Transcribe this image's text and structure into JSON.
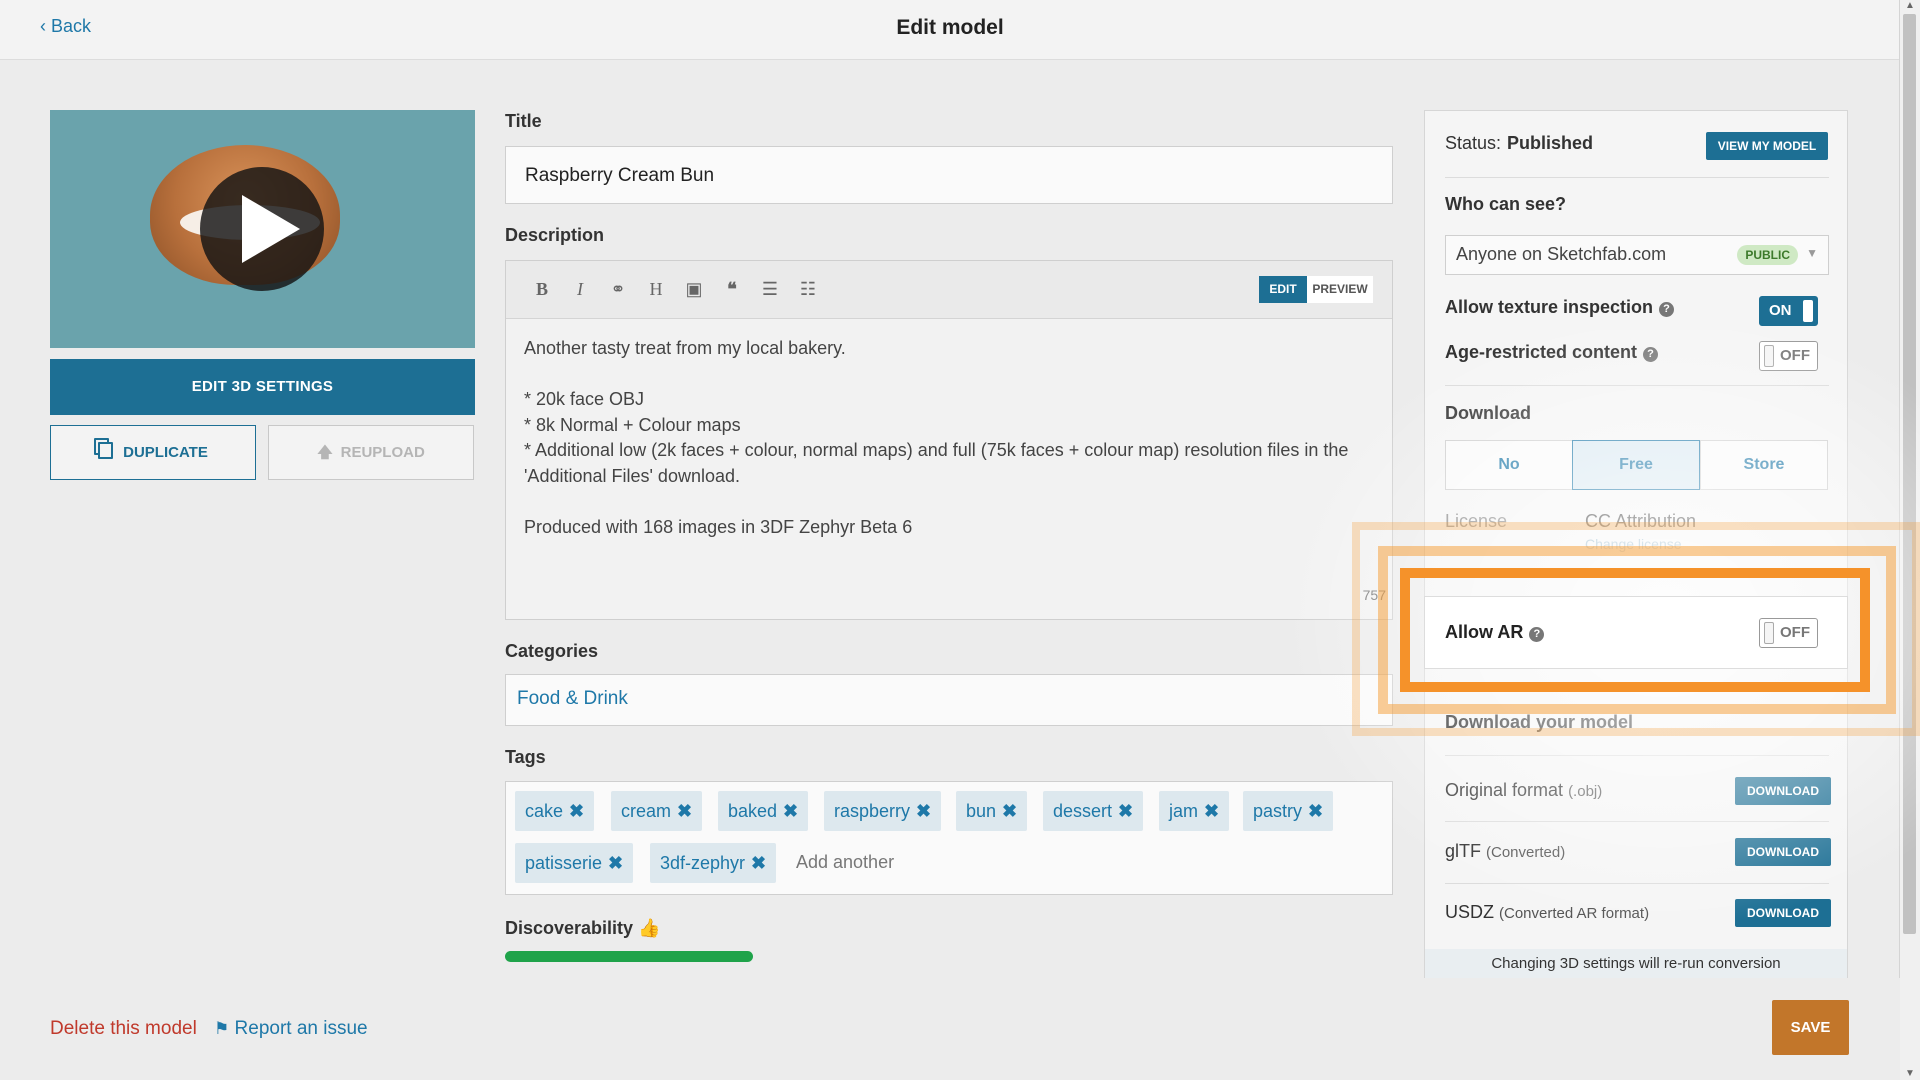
{
  "header": {
    "back_label": "‹ Back",
    "title": "Edit model"
  },
  "left": {
    "edit_3d_label": "EDIT 3D SETTINGS",
    "duplicate_label": "DUPLICATE",
    "reupload_label": "REUPLOAD"
  },
  "form": {
    "title_label": "Title",
    "title_value": "Raspberry Cream Bun",
    "description_label": "Description",
    "toolbar_icons": [
      "bold-icon",
      "italic-icon",
      "link-icon",
      "heading-icon",
      "image-icon",
      "quote-icon",
      "numbered-list-icon",
      "bullet-list-icon"
    ],
    "edit_tab": "EDIT",
    "preview_tab": "PREVIEW",
    "description_lines": [
      "Another tasty treat from my local bakery.",
      "",
      "* 20k face OBJ",
      "* 8k Normal + Colour maps",
      "* Additional low (2k faces + colour, normal maps) and full (75k faces + colour map) resolution files in the 'Additional Files' download.",
      "",
      "Produced with 168 images in 3DF Zephyr Beta 6"
    ],
    "char_counter": "757",
    "categories_label": "Categories",
    "category_value": "Food & Drink",
    "tags_label": "Tags",
    "tags": [
      "cake",
      "cream",
      "baked",
      "raspberry",
      "bun",
      "dessert",
      "jam",
      "pastry",
      "patisserie",
      "3df-zephyr"
    ],
    "add_tag_placeholder": "Add another",
    "discoverability_label": "Discoverability",
    "discoverability_level": 0.4
  },
  "panel": {
    "status_label": "Status:",
    "status_value": "Published",
    "view_model_label": "VIEW MY MODEL",
    "who_can_see_label": "Who can see?",
    "visibility_value": "Anyone on Sketchfab.com",
    "visibility_badge": "PUBLIC",
    "texture_inspection_label": "Allow texture inspection",
    "texture_inspection_state": "ON",
    "age_restricted_label": "Age-restricted content",
    "age_restricted_state": "OFF",
    "download_label": "Download",
    "download_options": [
      "No",
      "Free",
      "Store"
    ],
    "download_selected": "Free",
    "license_label": "License",
    "license_value": "CC Attribution",
    "change_license_label": "Change license",
    "allow_ar_label": "Allow AR",
    "allow_ar_state": "OFF",
    "download_model_label": "Download your model",
    "formats": [
      {
        "name": "Original format",
        "note": "(.obj)",
        "button": "DOWNLOAD"
      },
      {
        "name": "glTF",
        "note": "(Converted)",
        "button": "DOWNLOAD"
      },
      {
        "name": "USDZ",
        "note": "(Converted AR format)",
        "button": "DOWNLOAD"
      }
    ],
    "conversion_note": "Changing 3D settings will re-run conversion"
  },
  "footer": {
    "delete_label": "Delete this model",
    "report_label": "Report an issue",
    "save_label": "SAVE"
  },
  "colors": {
    "accent": "#1d6f94",
    "link": "#1e78a8",
    "save": "#c2762a",
    "highlight": "#f5922a",
    "danger": "#c0392b"
  }
}
